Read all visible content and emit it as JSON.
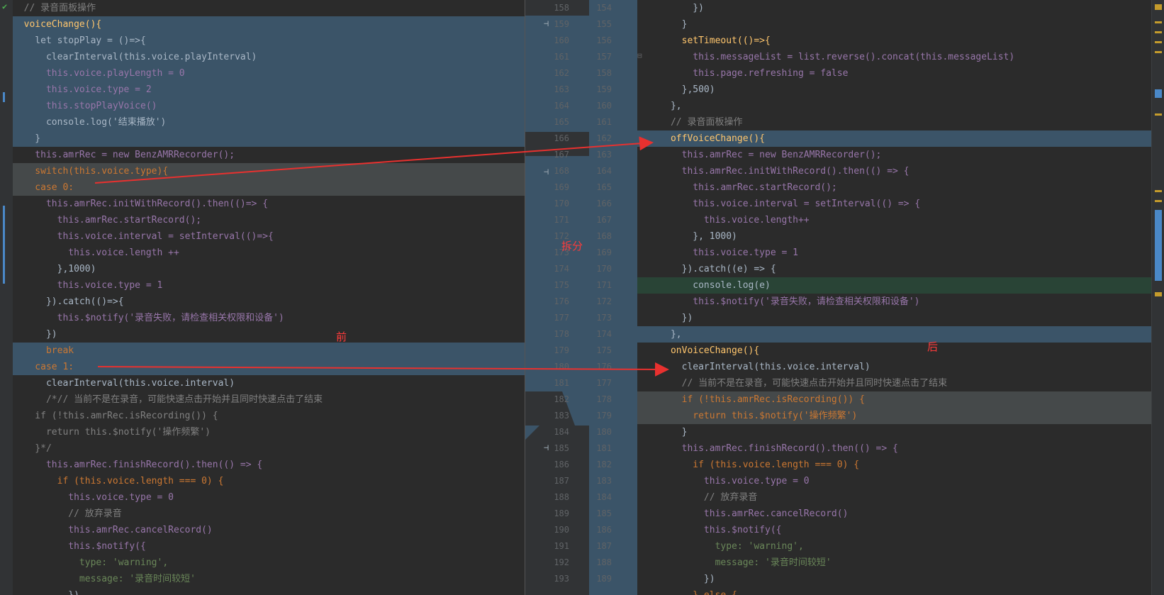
{
  "left": {
    "lines": [
      {
        "text": "  // 录音面板操作",
        "cls": "c",
        "bg": "dark"
      },
      {
        "text": "  voiceChange(){",
        "cls": "f",
        "bg": "blue"
      },
      {
        "text": "    let stopPlay = ()=>{",
        "cls": "p",
        "bg": "blue"
      },
      {
        "text": "      clearInterval(this.voice.playInterval)",
        "cls": "p",
        "bg": "blue"
      },
      {
        "text": "      this.voice.playLength = 0",
        "cls": "t",
        "bg": "blue"
      },
      {
        "text": "      this.voice.type = 2",
        "cls": "t",
        "bg": "blue"
      },
      {
        "text": "      this.stopPlayVoice()",
        "cls": "t",
        "bg": "blue"
      },
      {
        "text": "      console.log('结束播放')",
        "cls": "p",
        "bg": "blue"
      },
      {
        "text": "    }",
        "cls": "p",
        "bg": "blue"
      },
      {
        "text": "    this.amrRec = new BenzAMRRecorder();",
        "cls": "t",
        "bg": "dark"
      },
      {
        "text": "    switch(this.voice.type){",
        "cls": "k",
        "bg": "gray"
      },
      {
        "text": "    case 0:",
        "cls": "k",
        "bg": "gray"
      },
      {
        "text": "      this.amrRec.initWithRecord().then(()=> {",
        "cls": "t",
        "bg": "dark"
      },
      {
        "text": "        this.amrRec.startRecord();",
        "cls": "t",
        "bg": "dark"
      },
      {
        "text": "        this.voice.interval = setInterval(()=>{",
        "cls": "t",
        "bg": "dark"
      },
      {
        "text": "          this.voice.length ++",
        "cls": "t",
        "bg": "dark"
      },
      {
        "text": "        },1000)",
        "cls": "p",
        "bg": "dark"
      },
      {
        "text": "        this.voice.type = 1",
        "cls": "t",
        "bg": "dark"
      },
      {
        "text": "      }).catch(()=>{",
        "cls": "p",
        "bg": "dark"
      },
      {
        "text": "        this.$notify('录音失败，请检查相关权限和设备')",
        "cls": "t",
        "bg": "dark"
      },
      {
        "text": "      })",
        "cls": "p",
        "bg": "dark"
      },
      {
        "text": "      break",
        "cls": "k",
        "bg": "blue"
      },
      {
        "text": "    case 1:",
        "cls": "k",
        "bg": "blue"
      },
      {
        "text": "      clearInterval(this.voice.interval)",
        "cls": "p",
        "bg": "dark"
      },
      {
        "text": "      /*// 当前不是在录音，可能快速点击开始并且同时快速点击了结束",
        "cls": "c",
        "bg": "dark"
      },
      {
        "text": "    if (!this.amrRec.isRecording()) {",
        "cls": "c",
        "bg": "dark"
      },
      {
        "text": "      return this.$notify('操作频繁')",
        "cls": "c",
        "bg": "dark"
      },
      {
        "text": "    }*/",
        "cls": "c",
        "bg": "dark"
      },
      {
        "text": "      this.amrRec.finishRecord().then(() => {",
        "cls": "t",
        "bg": "dark"
      },
      {
        "text": "        if (this.voice.length === 0) {",
        "cls": "k",
        "bg": "dark"
      },
      {
        "text": "          this.voice.type = 0",
        "cls": "t",
        "bg": "dark"
      },
      {
        "text": "          // 放弃录音",
        "cls": "c",
        "bg": "dark"
      },
      {
        "text": "          this.amrRec.cancelRecord()",
        "cls": "t",
        "bg": "dark"
      },
      {
        "text": "          this.$notify({",
        "cls": "t",
        "bg": "dark"
      },
      {
        "text": "            type: 'warning',",
        "cls": "s",
        "bg": "dark"
      },
      {
        "text": "            message: '录音时间较短'",
        "cls": "s",
        "bg": "dark"
      },
      {
        "text": "          })",
        "cls": "p",
        "bg": "dark"
      }
    ]
  },
  "gutter": {
    "left_numbers": [
      "158",
      "159",
      "160",
      "161",
      "162",
      "163",
      "164",
      "165",
      "166",
      "167",
      "168",
      "169",
      "170",
      "171",
      "172",
      "173",
      "174",
      "175",
      "176",
      "177",
      "178",
      "179",
      "180",
      "181",
      "182",
      "183",
      "184",
      "185",
      "186",
      "187",
      "188",
      "189",
      "190",
      "191",
      "192",
      "193"
    ],
    "right_numbers": [
      "154",
      "155",
      "156",
      "157",
      "158",
      "159",
      "160",
      "161",
      "162",
      "163",
      "164",
      "165",
      "166",
      "167",
      "168",
      "169",
      "170",
      "171",
      "172",
      "173",
      "174",
      "175",
      "176",
      "177",
      "178",
      "179",
      "180",
      "181",
      "182",
      "183",
      "184",
      "185",
      "186",
      "187",
      "188",
      "189"
    ]
  },
  "right": {
    "lines": [
      {
        "text": "          })",
        "cls": "p",
        "bg": "dark"
      },
      {
        "text": "        }",
        "cls": "p",
        "bg": "dark"
      },
      {
        "text": "        setTimeout(()=>{",
        "cls": "f",
        "bg": "dark"
      },
      {
        "text": "          this.messageList = list.reverse().concat(this.messageList)",
        "cls": "t",
        "bg": "dark"
      },
      {
        "text": "          this.page.refreshing = false",
        "cls": "t",
        "bg": "dark"
      },
      {
        "text": "        },500)",
        "cls": "p",
        "bg": "dark"
      },
      {
        "text": "      },",
        "cls": "p",
        "bg": "dark"
      },
      {
        "text": "      // 录音面板操作",
        "cls": "c",
        "bg": "dark"
      },
      {
        "text": "      offVoiceChange(){",
        "cls": "f",
        "bg": "blue"
      },
      {
        "text": "        this.amrRec = new BenzAMRRecorder();",
        "cls": "t",
        "bg": "dark"
      },
      {
        "text": "        this.amrRec.initWithRecord().then(() => {",
        "cls": "t",
        "bg": "dark"
      },
      {
        "text": "          this.amrRec.startRecord();",
        "cls": "t",
        "bg": "dark"
      },
      {
        "text": "          this.voice.interval = setInterval(() => {",
        "cls": "t",
        "bg": "dark"
      },
      {
        "text": "            this.voice.length++",
        "cls": "t",
        "bg": "dark"
      },
      {
        "text": "          }, 1000)",
        "cls": "p",
        "bg": "dark"
      },
      {
        "text": "          this.voice.type = 1",
        "cls": "t",
        "bg": "dark"
      },
      {
        "text": "        }).catch((e) => {",
        "cls": "p",
        "bg": "dark"
      },
      {
        "text": "          console.log(e)",
        "cls": "p",
        "bg": "green"
      },
      {
        "text": "          this.$notify('录音失败，请检查相关权限和设备')",
        "cls": "t",
        "bg": "dark"
      },
      {
        "text": "        })",
        "cls": "p",
        "bg": "dark"
      },
      {
        "text": "      },",
        "cls": "p",
        "bg": "blue"
      },
      {
        "text": "      onVoiceChange(){",
        "cls": "f",
        "bg": "dark"
      },
      {
        "text": "        clearInterval(this.voice.interval)",
        "cls": "p",
        "bg": "dark"
      },
      {
        "text": "        // 当前不是在录音，可能快速点击开始并且同时快速点击了结束",
        "cls": "c",
        "bg": "dark"
      },
      {
        "text": "        if (!this.amrRec.isRecording()) {",
        "cls": "k",
        "bg": "gray"
      },
      {
        "text": "          return this.$notify('操作频繁')",
        "cls": "k",
        "bg": "gray"
      },
      {
        "text": "        }",
        "cls": "p",
        "bg": "dark"
      },
      {
        "text": "        this.amrRec.finishRecord().then(() => {",
        "cls": "t",
        "bg": "dark"
      },
      {
        "text": "          if (this.voice.length === 0) {",
        "cls": "k",
        "bg": "dark"
      },
      {
        "text": "            this.voice.type = 0",
        "cls": "t",
        "bg": "dark"
      },
      {
        "text": "            // 放弃录音",
        "cls": "c",
        "bg": "dark"
      },
      {
        "text": "            this.amrRec.cancelRecord()",
        "cls": "t",
        "bg": "dark"
      },
      {
        "text": "            this.$notify({",
        "cls": "t",
        "bg": "dark"
      },
      {
        "text": "              type: 'warning',",
        "cls": "s",
        "bg": "dark"
      },
      {
        "text": "              message: '录音时间较短'",
        "cls": "s",
        "bg": "dark"
      },
      {
        "text": "            })",
        "cls": "p",
        "bg": "dark"
      },
      {
        "text": "          } else {",
        "cls": "k",
        "bg": "dark"
      }
    ]
  },
  "annotations": {
    "split": "拆分",
    "before": "前",
    "after": "后"
  },
  "colors": {
    "arrow": "#e8312f",
    "changed_block": "#3b5468",
    "inserted": "#294436"
  }
}
